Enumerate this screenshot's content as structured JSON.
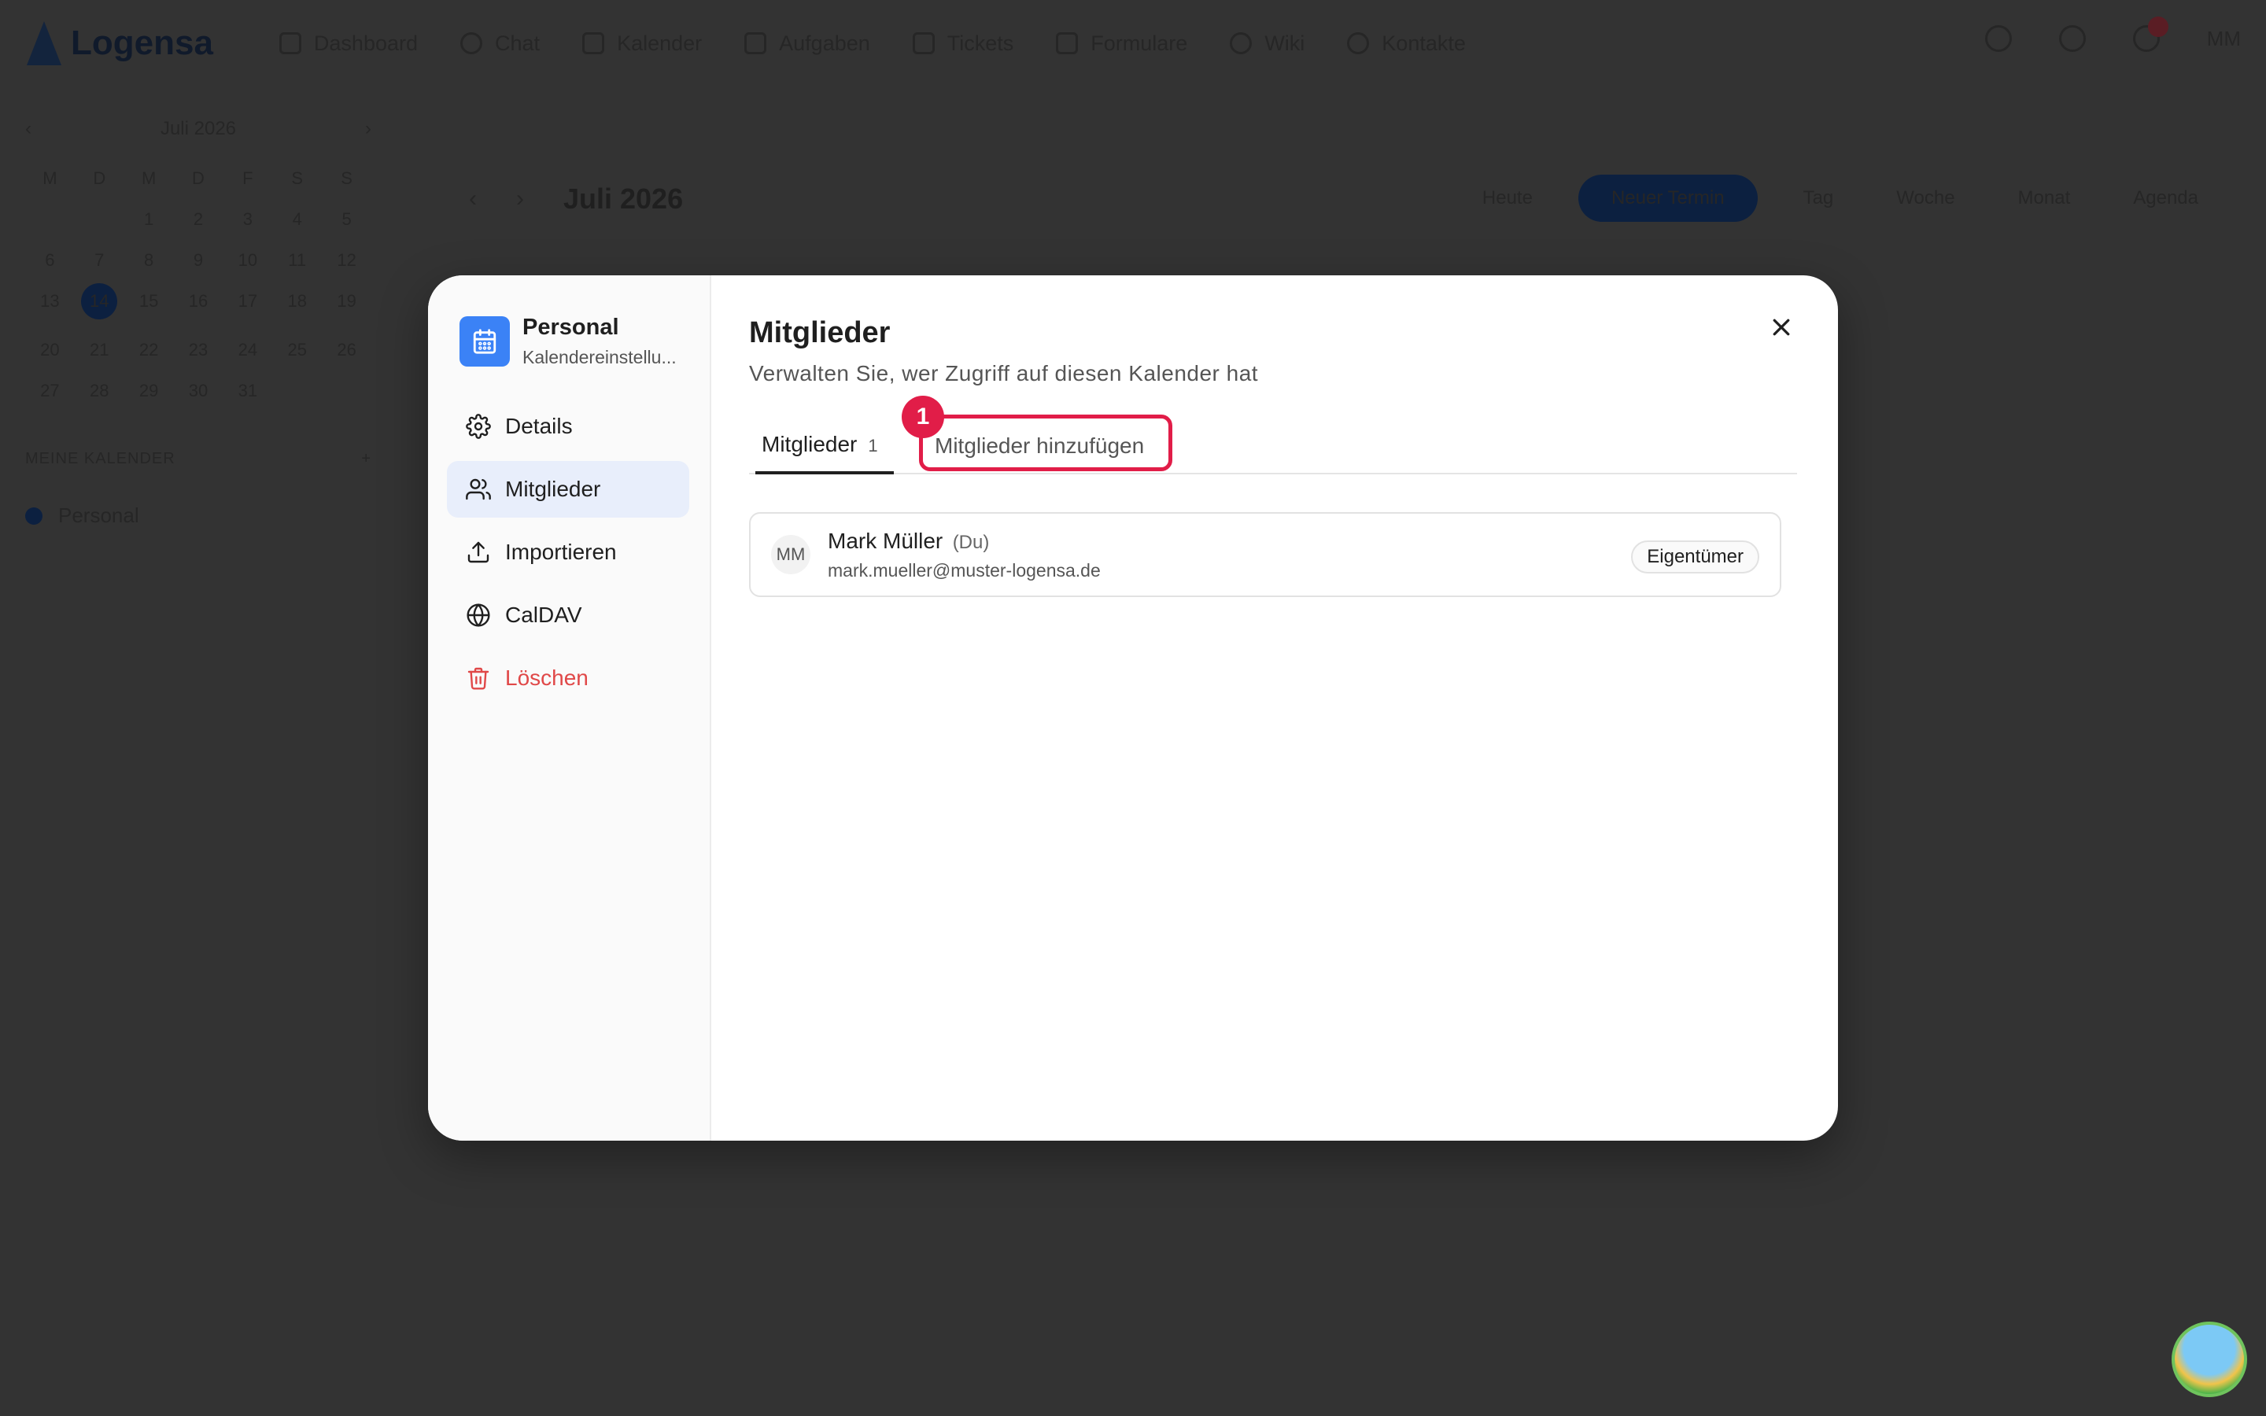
{
  "app": {
    "logo_text": "Logensa",
    "nav": [
      "Dashboard",
      "Chat",
      "Kalender",
      "Aufgaben",
      "Tickets",
      "Formulare",
      "Wiki",
      "Kontakte"
    ],
    "user_initials": "MM"
  },
  "background": {
    "mini_cal_month": "Juli 2026",
    "weekdays": [
      "M",
      "D",
      "M",
      "D",
      "F",
      "S",
      "S"
    ],
    "days": [
      "",
      "",
      "1",
      "2",
      "3",
      "4",
      "5",
      "6",
      "7",
      "8",
      "9",
      "10",
      "11",
      "12",
      "13",
      "14",
      "15",
      "16",
      "17",
      "18",
      "19",
      "20",
      "21",
      "22",
      "23",
      "24",
      "25",
      "26",
      "27",
      "28",
      "29",
      "30",
      "31"
    ],
    "selected_day": "14",
    "calendars_heading": "MEINE KALENDER",
    "calendar_entry": "Personal",
    "toolbar_title": "Juli 2026",
    "today_label": "Heute",
    "new_event_label": "Neuer Termin",
    "views": [
      "Tag",
      "Woche",
      "Monat",
      "Agenda"
    ]
  },
  "modal": {
    "sidebar": {
      "title": "Personal",
      "subtitle": "Kalendereinstellu...",
      "items": [
        {
          "label": "Details"
        },
        {
          "label": "Mitglieder"
        },
        {
          "label": "Importieren"
        },
        {
          "label": "CalDAV"
        },
        {
          "label": "Löschen"
        }
      ]
    },
    "title": "Mitglieder",
    "subtitle": "Verwalten Sie, wer Zugriff auf diesen Kalender hat",
    "tabs": {
      "members": "Mitglieder",
      "members_count": "1",
      "add": "Mitglieder hinzufügen"
    },
    "annotation_number": "1",
    "members": [
      {
        "initials": "MM",
        "name": "Mark Müller",
        "you": "(Du)",
        "email": "mark.mueller@muster-logensa.de",
        "role": "Eigentümer"
      }
    ]
  },
  "colors": {
    "accent": "#3b82f6",
    "active_bg": "#e8eefb",
    "danger": "#e04848",
    "highlight": "#e11d48"
  }
}
